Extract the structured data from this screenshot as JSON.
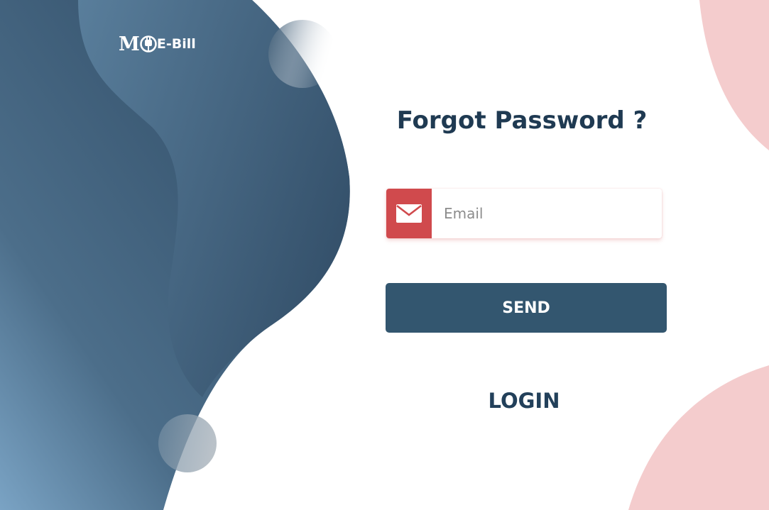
{
  "brand": {
    "logo_mark": "M",
    "logo_text": "E-Bill",
    "plug_icon": "plug-icon"
  },
  "form": {
    "title": "Forgot Password ?",
    "email_icon": "envelope-icon",
    "email_placeholder": "Email",
    "email_value": "",
    "send_label": "SEND",
    "login_label": "LOGIN"
  },
  "colors": {
    "brand_dark": "#33566f",
    "accent_red": "#d04a4d",
    "title_text": "#1f3a52",
    "pink_blob": "#f4cccd"
  }
}
